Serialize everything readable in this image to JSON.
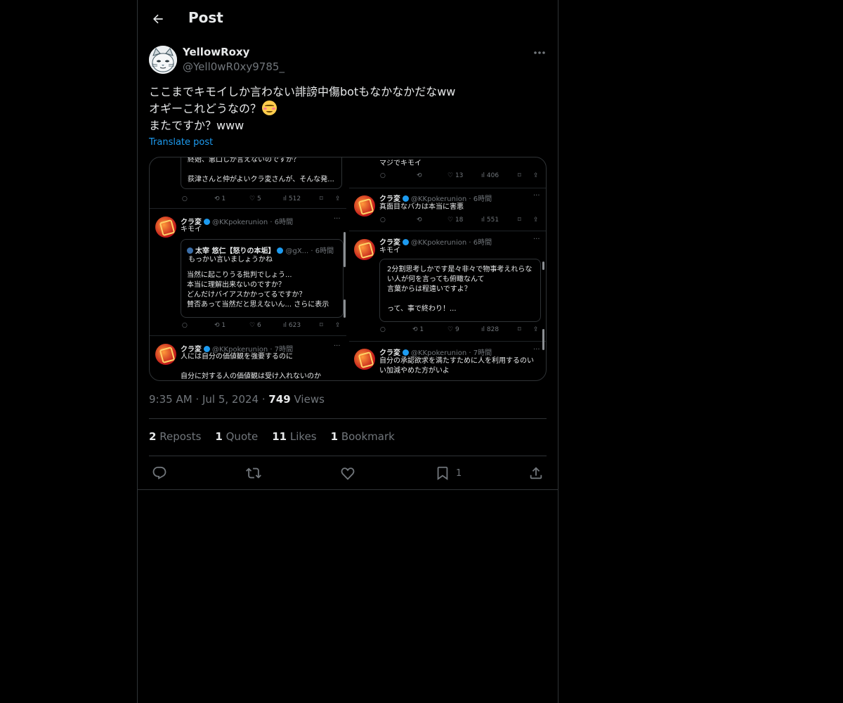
{
  "header": {
    "title": "Post"
  },
  "author": {
    "display_name": "YellowRoxy",
    "handle": "@Yell0wR0xy9785_"
  },
  "post": {
    "lines": [
      "ここまでキモイしか言わない誹謗中傷botもなかなかだなww",
      "オギーこれどうなの？",
      "またですか？www"
    ],
    "emoji": "smiling-face-with-blush",
    "translate_label": "Translate post"
  },
  "media": {
    "left": {
      "top_card": {
        "lines": [
          "終始、悪口しか言えないのですか？",
          "荻津さんと仲がよいクラ変さんが、そんな発..."
        ],
        "actions": [
          "1",
          "5",
          "512"
        ]
      },
      "reply_card": {
        "name": "クラ変",
        "meta": "@KKpokerunion · 6時間",
        "text": "キモイ",
        "quote_name": "太宰 悠仁【怒りの本垢】",
        "quote_meta": "@gX... · 6時間",
        "quote_lines": [
          "もっかい言いましょうかね",
          "当然に起こりうる批判でしょう...",
          "本当に理解出来ないのですか？",
          "どんだけバイアスかかってるですか？",
          "賛否あって当然だと思えないん... さらに表示"
        ],
        "actions": [
          "1",
          "6",
          "623"
        ]
      },
      "bottom_card": {
        "name": "クラ変",
        "meta": "@KKpokerunion · 7時間",
        "lines": [
          "人には自分の価値観を強要するのに",
          "自分に対する人の価値観は受け入れないのか"
        ]
      }
    },
    "right": {
      "top_card": {
        "text": "マジでキモイ",
        "actions": [
          "13",
          "406"
        ]
      },
      "card2": {
        "name": "クラ変",
        "meta": "@KKpokerunion · 6時間",
        "text": "真面目なバカは本当に害悪",
        "actions": [
          "18",
          "551"
        ]
      },
      "card3": {
        "name": "クラ変",
        "meta": "@KKpokerunion · 6時間",
        "text": "キモイ",
        "quote_lines": [
          "2分割思考しかです是々非々で物事考えれらな",
          "い人が何を言っても俯瞰なんて",
          "言葉からは程遠いですよ？",
          "って、事で終わり！..."
        ],
        "actions": [
          "1",
          "9",
          "828"
        ]
      },
      "card4": {
        "name": "クラ変",
        "meta": "@KKpokerunion · 7時間",
        "lines": [
          "自分の承認欲求を満たすために人を利用するのい",
          "い加減やめた方がいよ"
        ]
      }
    }
  },
  "meta": {
    "time": "9:35 AM",
    "date": "Jul 5, 2024",
    "views_count": "749",
    "views_label": "Views"
  },
  "stats": [
    {
      "count": "2",
      "label": "Reposts"
    },
    {
      "count": "1",
      "label": "Quote"
    },
    {
      "count": "11",
      "label": "Likes"
    },
    {
      "count": "1",
      "label": "Bookmark"
    }
  ],
  "actions": {
    "bookmark_count": "1"
  },
  "colors": {
    "background": "#000000",
    "border": "#2f3336",
    "text": "#e7e9ea",
    "muted": "#71767b",
    "link": "#1d9bf0"
  }
}
